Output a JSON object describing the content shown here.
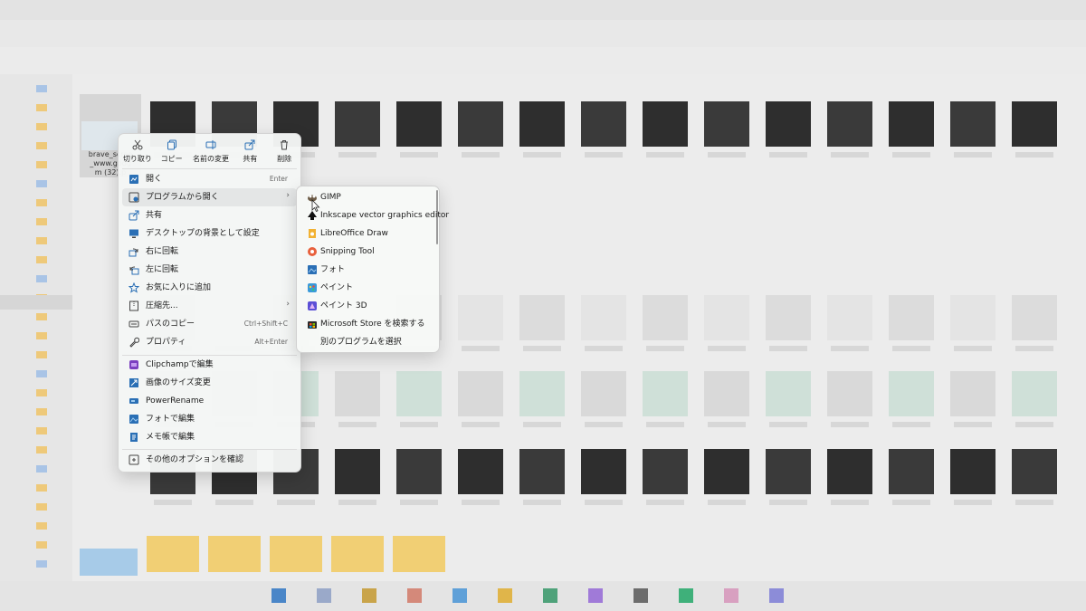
{
  "file": {
    "name": "brave_screenshot_www.google.com (32).png",
    "display_lines": [
      "brave_scree",
      "_www.goog",
      "m (32).p"
    ]
  },
  "quick_actions": [
    {
      "label": "切り取り",
      "icon": "cut-icon"
    },
    {
      "label": "コピー",
      "icon": "copy-icon"
    },
    {
      "label": "名前の変更",
      "icon": "rename-icon"
    },
    {
      "label": "共有",
      "icon": "share-icon"
    },
    {
      "label": "削除",
      "icon": "delete-icon"
    }
  ],
  "menu": {
    "open": {
      "label": "開く",
      "shortcut": "Enter",
      "icon": "open-icon"
    },
    "open_with": {
      "label": "プログラムから開く",
      "arrow": "›",
      "icon": "open-with-icon"
    },
    "share": {
      "label": "共有",
      "icon": "share-icon"
    },
    "set_background": {
      "label": "デスクトップの背景として設定",
      "icon": "desktop-background-icon"
    },
    "rotate_right": {
      "label": "右に回転",
      "icon": "rotate-right-icon"
    },
    "rotate_left": {
      "label": "左に回転",
      "icon": "rotate-left-icon"
    },
    "add_favorites": {
      "label": "お気に入りに追加",
      "icon": "star-icon"
    },
    "compress": {
      "label": "圧縮先...",
      "arrow": "›",
      "icon": "compress-icon"
    },
    "copy_path": {
      "label": "パスのコピー",
      "shortcut": "Ctrl+Shift+C",
      "icon": "copy-path-icon"
    },
    "properties": {
      "label": "プロパティ",
      "shortcut": "Alt+Enter",
      "icon": "wrench-icon"
    },
    "clipchamp": {
      "label": "Clipchampで編集",
      "icon": "clipchamp-icon"
    },
    "resize": {
      "label": "画像のサイズ変更",
      "icon": "resize-icon"
    },
    "power_rename": {
      "label": "PowerRename",
      "icon": "power-rename-icon"
    },
    "edit_photos": {
      "label": "フォトで編集",
      "icon": "photos-icon"
    },
    "edit_notepad": {
      "label": "メモ帳で編集",
      "icon": "notepad-icon"
    },
    "more_options": {
      "label": "その他のオプションを確認",
      "icon": "more-options-icon"
    }
  },
  "open_with_submenu": [
    {
      "label": "GIMP",
      "icon": "gimp-icon"
    },
    {
      "label": "Inkscape vector graphics editor",
      "icon": "inkscape-icon"
    },
    {
      "label": "LibreOffice Draw",
      "icon": "libreoffice-draw-icon"
    },
    {
      "label": "Snipping Tool",
      "icon": "snipping-tool-icon"
    },
    {
      "label": "フォト",
      "icon": "photos-icon"
    },
    {
      "label": "ペイント",
      "icon": "paint-icon"
    },
    {
      "label": "ペイント 3D",
      "icon": "paint-3d-icon"
    },
    {
      "label": "Microsoft Store を検索する",
      "icon": "store-icon"
    },
    {
      "label": "別のプログラムを選択",
      "icon": ""
    }
  ]
}
